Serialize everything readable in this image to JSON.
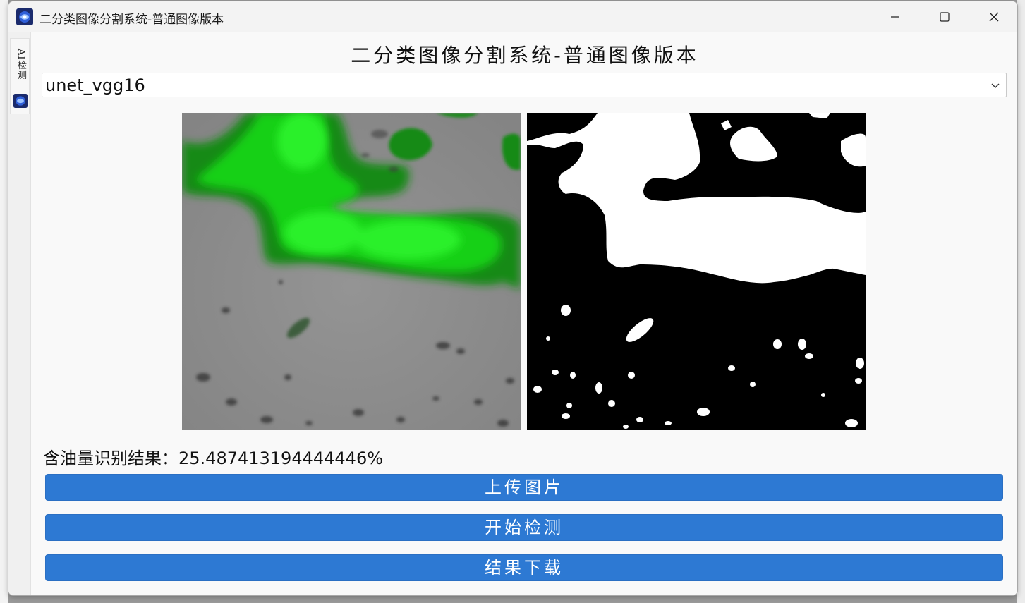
{
  "window": {
    "title": "二分类图像分割系统-普通图像版本"
  },
  "side_tab": {
    "label": "AI检测"
  },
  "main": {
    "heading": "二分类图像分割系统-普通图像版本",
    "model_select": {
      "selected": "unet_vgg16"
    },
    "result": {
      "label": "含油量识别结果：",
      "value": "25.487413194444446%"
    },
    "buttons": {
      "upload": "上传图片",
      "detect": "开始检测",
      "download": "结果下载"
    }
  },
  "images": {
    "left": "oil-overlay-image",
    "right": "binary-mask-image"
  },
  "colors": {
    "accent": "#2d79d3",
    "overlay_green": "#17d017",
    "background_gray": "#8e8e8e"
  }
}
